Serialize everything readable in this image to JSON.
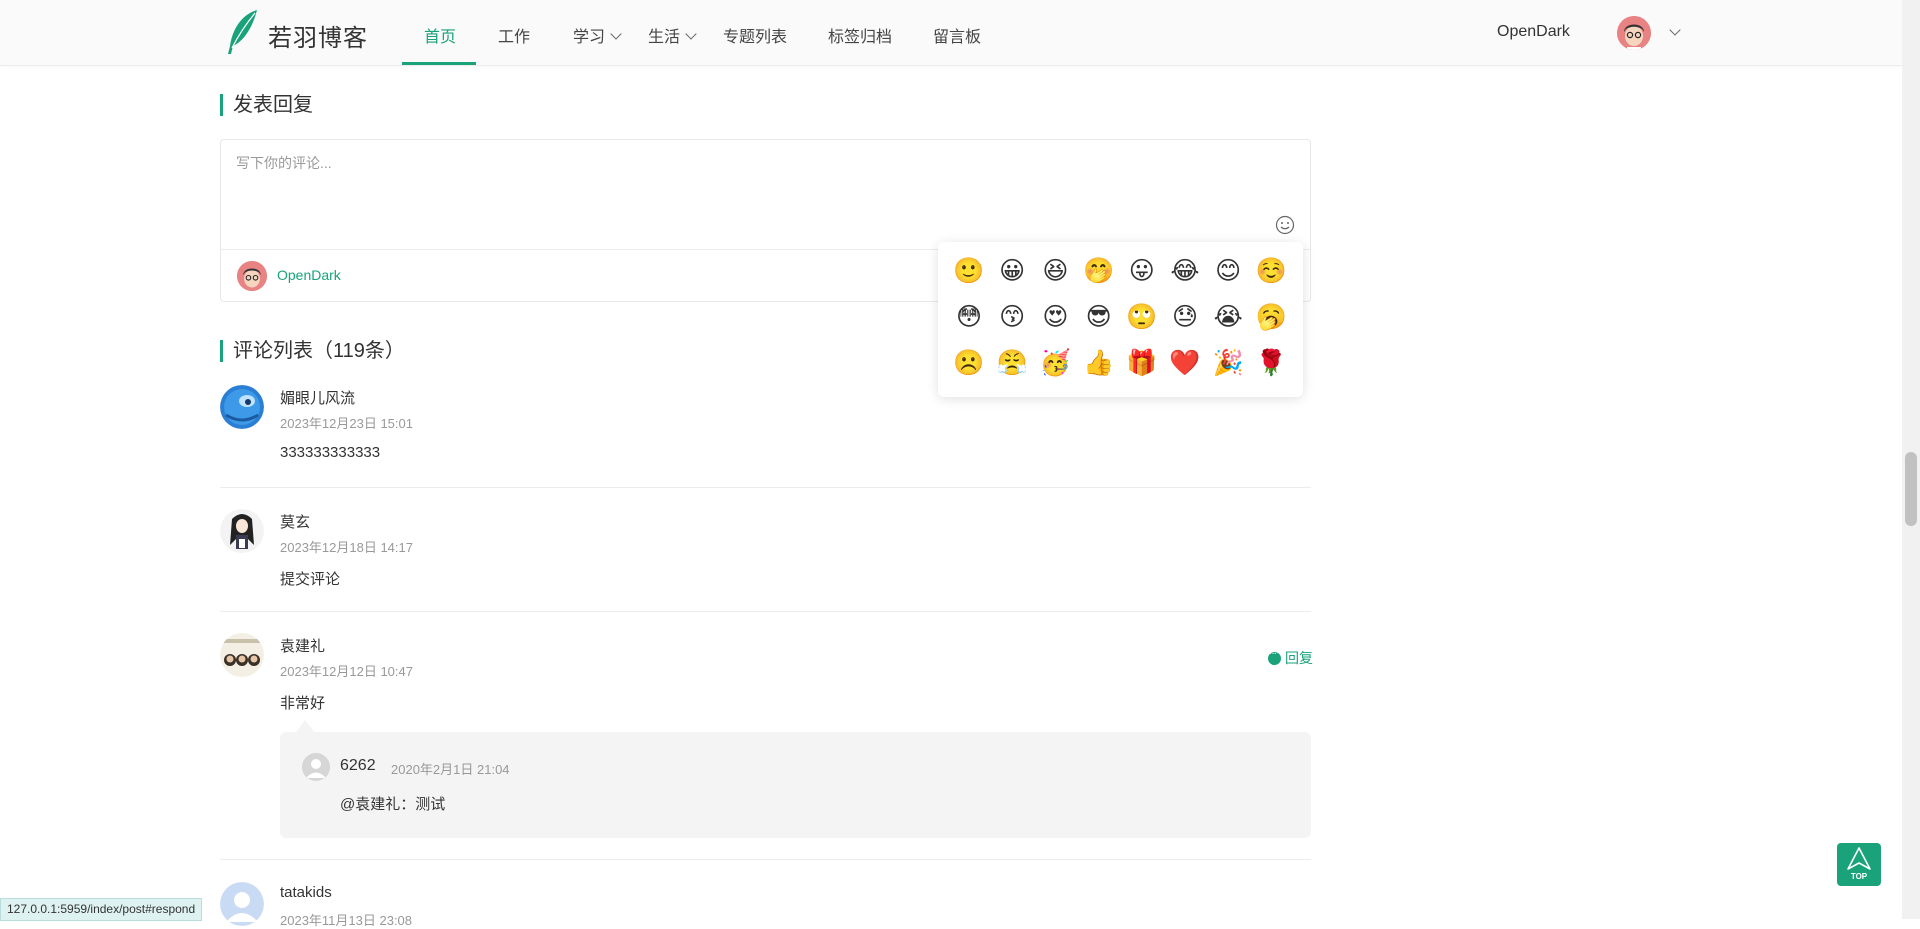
{
  "site": {
    "title": "若羽博客"
  },
  "nav": {
    "items": [
      {
        "label": "首页",
        "active": true
      },
      {
        "label": "工作"
      },
      {
        "label": "学习",
        "dropdown": true
      },
      {
        "label": "生活",
        "dropdown": true
      },
      {
        "label": "专题列表"
      },
      {
        "label": "标签归档"
      },
      {
        "label": "留言板"
      }
    ]
  },
  "user": {
    "name": "OpenDark"
  },
  "reply_section": {
    "title": "发表回复",
    "placeholder": "写下你的评论...",
    "user_name": "OpenDark"
  },
  "emoji_panel": {
    "emojis": [
      "🙂",
      "😀",
      "😆",
      "🤭",
      "😛",
      "😂",
      "😊",
      "☺️",
      "😳",
      "😙",
      "😍",
      "😎",
      "🙄",
      "😓",
      "😭",
      "🥱",
      "☹️",
      "😤",
      "🥳",
      "👍",
      "🎁",
      "❤️",
      "🎉",
      "🌹"
    ]
  },
  "comments_section": {
    "title": "评论列表（119条）"
  },
  "comments": [
    {
      "name": "媚眼儿风流",
      "time": "2023年12月23日 15:01",
      "text": "333333333333"
    },
    {
      "name": "莫玄",
      "time": "2023年12月18日 14:17",
      "text": "提交评论"
    },
    {
      "name": "袁建礼",
      "time": "2023年12月12日 10:47",
      "text": "非常好",
      "reply_label": "回复",
      "replies": [
        {
          "name": "6262",
          "time": "2020年2月1日 21:04",
          "text": "@袁建礼：测试"
        }
      ]
    },
    {
      "name": "tatakids",
      "time": "2023年11月13日 23:08"
    }
  ],
  "top_button": {
    "label": "TOP"
  },
  "status_bar": {
    "url": "127.0.0.1:5959/index/post#respond"
  },
  "colors": {
    "accent": "#1aa37a",
    "text": "#333333",
    "muted": "#999999"
  }
}
